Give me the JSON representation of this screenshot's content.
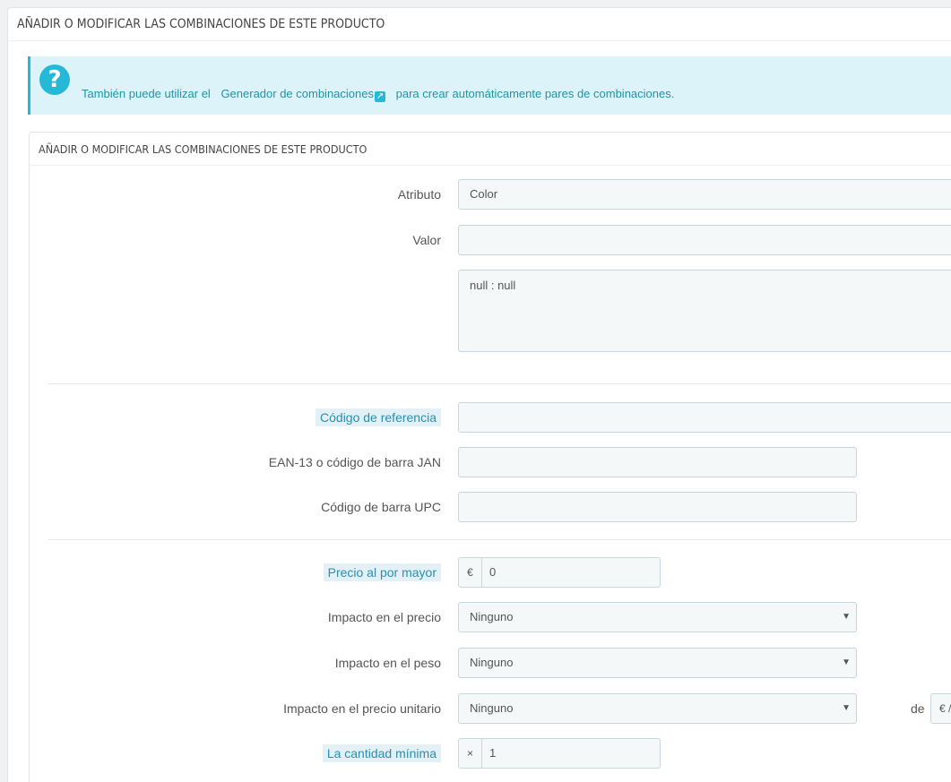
{
  "outer_panel": {
    "heading": "AÑADIR O MODIFICAR LAS COMBINACIONES DE ESTE PRODUCTO"
  },
  "alert": {
    "icon": "question-icon",
    "text_before": "También puede utilizar el",
    "link_text": "Generador de combinaciones",
    "text_after": "para crear automáticamente pares de combinaciones."
  },
  "inner_panel": {
    "heading": "AÑADIR O MODIFICAR LAS COMBINACIONES DE ESTE PRODUCTO",
    "attribute": {
      "label": "Atributo",
      "value": "Color"
    },
    "value": {
      "label": "Valor",
      "value": ""
    },
    "combination_list": {
      "value": "null : null"
    },
    "reference": {
      "label": "Código de referencia",
      "value": ""
    },
    "ean13": {
      "label": "EAN-13 o código de barra JAN",
      "value": ""
    },
    "upc": {
      "label": "Código de barra UPC",
      "value": ""
    },
    "wholesale_price": {
      "label": "Precio al por mayor",
      "addon": "€",
      "value": "0"
    },
    "price_impact": {
      "label": "Impacto en el precio",
      "value": "Ninguno"
    },
    "weight_impact": {
      "label": "Impacto en el peso",
      "value": "Ninguno"
    },
    "unit_price_impact": {
      "label": "Impacto en el precio unitario",
      "value": "Ninguno",
      "de_label": "de",
      "de_value": "€ /"
    },
    "min_quantity": {
      "label": "La cantidad mínima",
      "addon": "×",
      "value": "1"
    }
  },
  "colors": {
    "accent": "#25b9d7",
    "alert_bg": "#dcf4f9",
    "label_highlight": "#e3f1f6"
  }
}
